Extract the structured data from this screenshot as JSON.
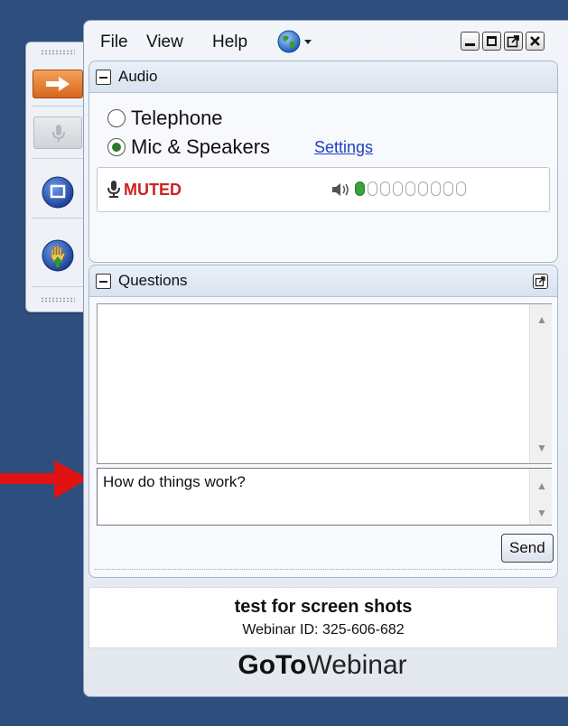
{
  "menu": {
    "file": "File",
    "view": "View",
    "help": "Help"
  },
  "audio": {
    "title": "Audio",
    "telephone": "Telephone",
    "mic_speakers": "Mic & Speakers",
    "settings": "Settings",
    "muted": "MUTED",
    "mode_selected": "mic_speakers"
  },
  "questions": {
    "title": "Questions",
    "input_value": "How do things work?",
    "send": "Send"
  },
  "webinar": {
    "title": "test for screen shots",
    "id_text": "Webinar ID: 325-606-682",
    "brand_bold": "GoTo",
    "brand_light": "Webinar"
  },
  "colors": {
    "background": "#2e4f7e",
    "muted": "#cc2222",
    "arrow": "#e01212",
    "link": "#1f3fbf"
  }
}
